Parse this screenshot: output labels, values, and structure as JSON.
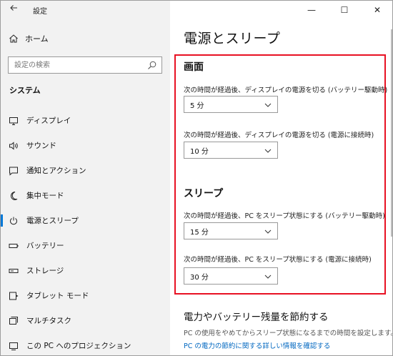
{
  "window": {
    "title": "設定",
    "back_icon": "back-arrow-icon",
    "controls": {
      "minimize": "—",
      "maximize": "☐",
      "close": "✕"
    }
  },
  "sidebar": {
    "home": {
      "label": "ホーム",
      "icon": "home-icon"
    },
    "search": {
      "placeholder": "設定の検索",
      "icon": "search-icon"
    },
    "section_title": "システム",
    "items": [
      {
        "label": "ディスプレイ",
        "icon": "monitor-icon"
      },
      {
        "label": "サウンド",
        "icon": "speaker-icon"
      },
      {
        "label": "通知とアクション",
        "icon": "notification-icon"
      },
      {
        "label": "集中モード",
        "icon": "moon-icon"
      },
      {
        "label": "電源とスリープ",
        "icon": "power-icon",
        "active": true
      },
      {
        "label": "バッテリー",
        "icon": "battery-icon"
      },
      {
        "label": "ストレージ",
        "icon": "storage-icon"
      },
      {
        "label": "タブレット モード",
        "icon": "tablet-icon"
      },
      {
        "label": "マルチタスク",
        "icon": "multitask-icon"
      },
      {
        "label": "この PC へのプロジェクション",
        "icon": "projection-icon"
      }
    ]
  },
  "main": {
    "title": "電源とスリープ",
    "screen": {
      "heading": "画面",
      "battery_label": "次の時間が経過後、ディスプレイの電源を切る (バッテリー駆動時)",
      "battery_value": "5 分",
      "plugged_label": "次の時間が経過後、ディスプレイの電源を切る (電源に接続時)",
      "plugged_value": "10 分"
    },
    "sleep": {
      "heading": "スリープ",
      "battery_label": "次の時間が経過後、PC をスリープ状態にする (バッテリー駆動時)",
      "battery_value": "15 分",
      "plugged_label": "次の時間が経過後、PC をスリープ状態にする (電源に接続時)",
      "plugged_value": "30 分"
    },
    "save": {
      "heading": "電力やバッテリー残量を節約する",
      "description": "PC の使用をやめてからスリープ状態になるまでの時間を設定します。",
      "link": "PC の電力の節約に関する詳しい情報を確認する"
    }
  },
  "colors": {
    "accent": "#0078d7",
    "highlight": "#e81123",
    "link": "#0067c0"
  }
}
